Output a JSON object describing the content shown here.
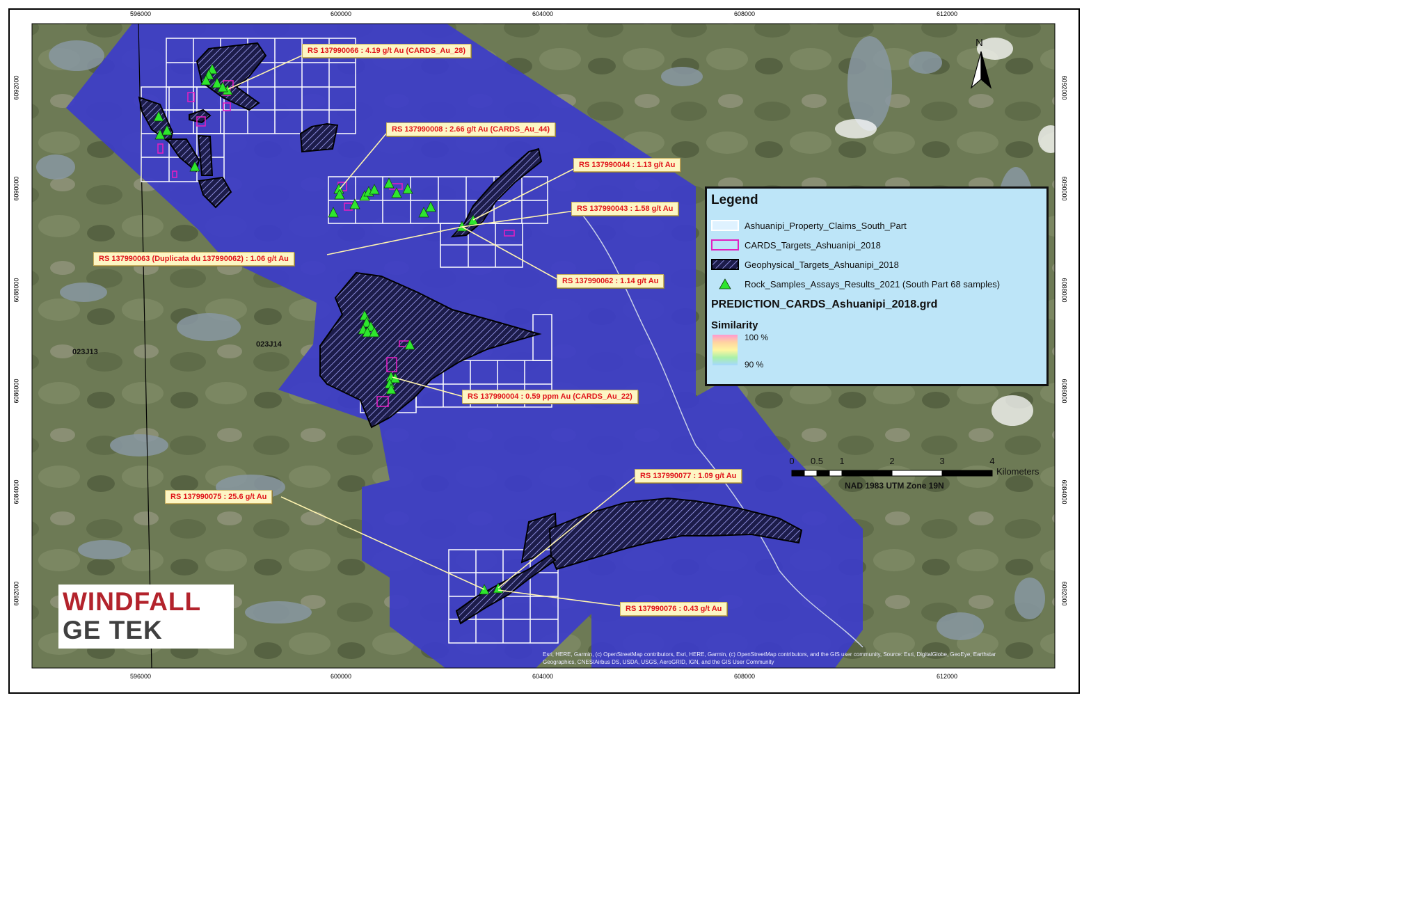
{
  "axes": {
    "x_ticks": [
      "596000",
      "600000",
      "604000",
      "608000",
      "612000"
    ],
    "y_ticks": [
      "6092000",
      "6090000",
      "6088000",
      "6086000",
      "6084000",
      "6082000"
    ]
  },
  "sheets": [
    "023J13",
    "023J14"
  ],
  "callouts": [
    {
      "text": "RS 137990066 : 4.19 g/t Au (CARDS_Au_28)"
    },
    {
      "text": "RS 137990008 : 2.66 g/t Au (CARDS_Au_44)"
    },
    {
      "text": "RS 137990044 : 1.13 g/t Au"
    },
    {
      "text": "RS 137990043 : 1.58 g/t Au"
    },
    {
      "text": "RS 137990063 (Duplicata du 137990062) : 1.06 g/t Au"
    },
    {
      "text": "RS 137990062 : 1.14 g/t Au"
    },
    {
      "text": "RS 137990004 : 0.59 ppm Au (CARDS_Au_22)"
    },
    {
      "text": "RS 137990077 : 1.09 g/t Au"
    },
    {
      "text": "RS 137990075 : 25.6 g/t Au"
    },
    {
      "text": "RS 137990076 : 0.43 g/t Au"
    }
  ],
  "legend": {
    "title": "Legend",
    "items": [
      {
        "label": "Ashuanipi_Property_Claims_South_Part"
      },
      {
        "label": "CARDS_Targets_Ashuanipi_2018"
      },
      {
        "label": "Geophysical_Targets_Ashuanipi_2018"
      },
      {
        "label": "Rock_Samples_Assays_Results_2021 (South Part 68 samples)"
      }
    ],
    "grid_title": "PREDICTION_CARDS_Ashuanipi_2018.grd",
    "similarity_title": "Similarity",
    "ramp_high": "100 %",
    "ramp_low": "90 %"
  },
  "scalebar": {
    "labels": [
      "0",
      "0.5",
      "1",
      "2",
      "3",
      "4"
    ],
    "units": "Kilometers",
    "projection": "NAD 1983 UTM Zone 19N"
  },
  "north_arrow": {
    "label": "N"
  },
  "attribution": "Esri, HERE, Garmin, (c) OpenStreetMap contributors, Esri, HERE, Garmin, (c) OpenStreetMap contributors, and the GIS user community, Source: Esri, DigitalGlobe, GeoEye, Earthstar Geographics, CNES/Airbus DS, USDA, USGS, AeroGRID, IGN, and the GIS User Community",
  "logo": {
    "line1": "WINDFALL",
    "line2": "GE TEK"
  },
  "colors": {
    "prediction_grid": "#3c3cc8",
    "claims": "#ffffff",
    "cards_targets": "#e020c0",
    "geophysical_fill": "#23235a",
    "rock_samples": "#2ee62e",
    "callout_text": "#e0141a",
    "legend_bg": "#bde5f8"
  }
}
